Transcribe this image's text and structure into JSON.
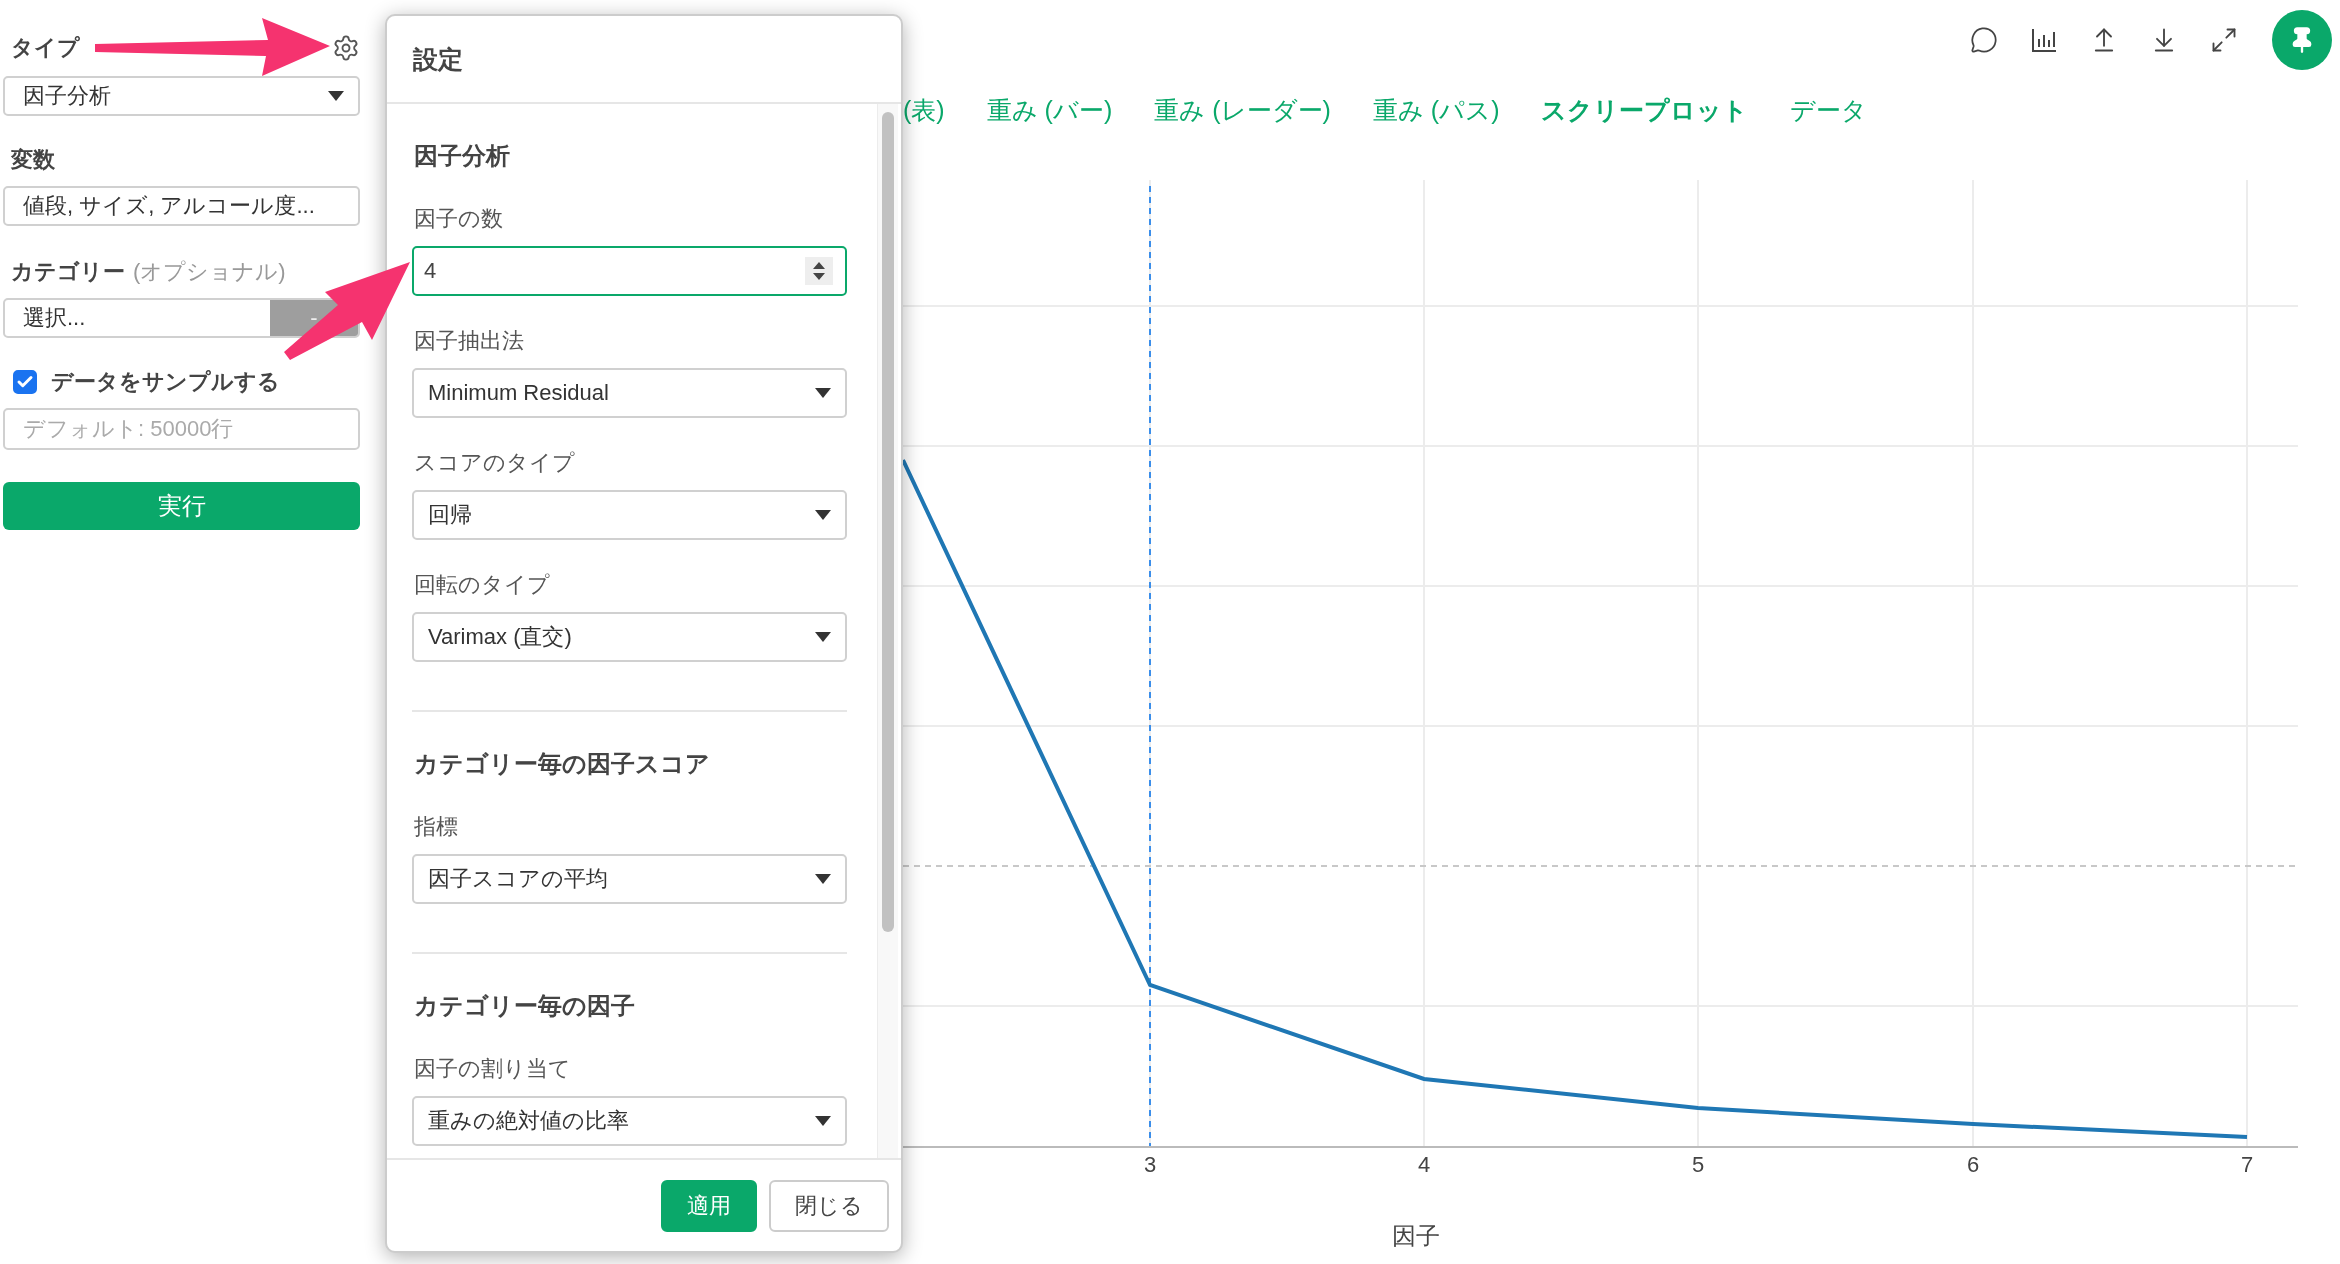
{
  "sidebar": {
    "type_label": "タイプ",
    "type_select": {
      "value": "因子分析"
    },
    "variables_label": "変数",
    "variables_field": {
      "value": "値段, サイズ, アルコール度..."
    },
    "category_label": "カテゴリー",
    "category_hint": "(オプショナル)",
    "category_select": {
      "value": "選択...",
      "button": "-"
    },
    "sample": {
      "label": "データをサンプルする",
      "checked": true
    },
    "sample_rows": {
      "placeholder": "デフォルト: 50000行"
    },
    "run_button": "実行"
  },
  "tabs": [
    {
      "label": "(表)",
      "selected": false
    },
    {
      "label": "重み (バー)",
      "selected": false
    },
    {
      "label": "重み (レーダー)",
      "selected": false
    },
    {
      "label": "重み (パス)",
      "selected": false
    },
    {
      "label": "スクリープロット",
      "selected": true
    },
    {
      "label": "データ",
      "selected": false
    }
  ],
  "chart": {
    "x_ticks": [
      "3",
      "4",
      "5",
      "6",
      "7"
    ],
    "x_title": "因子"
  },
  "dialog": {
    "title": "設定",
    "sections": [
      {
        "title": "因子分析",
        "fields": [
          {
            "kind": "number",
            "label": "因子の数",
            "value": "4",
            "focused": true
          },
          {
            "kind": "select",
            "label": "因子抽出法",
            "value": "Minimum Residual"
          },
          {
            "kind": "select",
            "label": "スコアのタイプ",
            "value": "回帰"
          },
          {
            "kind": "select",
            "label": "回転のタイプ",
            "value": "Varimax (直交)"
          }
        ]
      },
      {
        "title": "カテゴリー毎の因子スコア",
        "fields": [
          {
            "kind": "select",
            "label": "指標",
            "value": "因子スコアの平均"
          }
        ]
      },
      {
        "title": "カテゴリー毎の因子",
        "fields": [
          {
            "kind": "select",
            "label": "因子の割り当て",
            "value": "重みの絶対値の比率"
          }
        ]
      }
    ],
    "buttons": [
      {
        "label": "適用",
        "primary": true
      },
      {
        "label": "閉じる",
        "primary": false
      }
    ]
  }
}
